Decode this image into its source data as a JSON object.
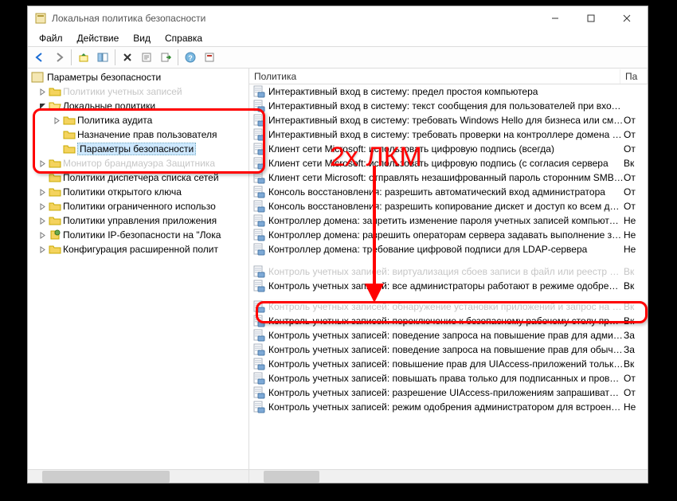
{
  "window": {
    "title": "Локальная политика безопасности"
  },
  "menubar": [
    "Файл",
    "Действие",
    "Вид",
    "Справка"
  ],
  "tree": {
    "root": "Параметры безопасности",
    "items": [
      {
        "label": "Политики учетных записей",
        "expandable": true,
        "depth": 0,
        "open": false,
        "dim": true
      },
      {
        "label": "Локальные политики",
        "expandable": true,
        "depth": 0,
        "open": true
      },
      {
        "label": "Политика аудита",
        "expandable": true,
        "depth": 1,
        "open": false
      },
      {
        "label": "Назначение прав пользователя",
        "expandable": false,
        "depth": 1,
        "open": false
      },
      {
        "label": "Параметры безопасности",
        "expandable": false,
        "depth": 1,
        "open": false,
        "selected": true
      },
      {
        "label": "Монитор брандмауэра Защитника",
        "expandable": true,
        "depth": 0,
        "open": false,
        "dim": true
      },
      {
        "label": "Политики диспетчера списка сетей",
        "expandable": false,
        "depth": 0,
        "open": false
      },
      {
        "label": "Политики открытого ключа",
        "expandable": true,
        "depth": 0,
        "open": false
      },
      {
        "label": "Политики ограниченного использо",
        "expandable": true,
        "depth": 0,
        "open": false
      },
      {
        "label": "Политики управления приложения",
        "expandable": true,
        "depth": 0,
        "open": false
      },
      {
        "label": "Политики IP-безопасности на \"Лока",
        "expandable": true,
        "depth": 0,
        "open": false,
        "ipsec": true
      },
      {
        "label": "Конфигурация расширенной полит",
        "expandable": true,
        "depth": 0,
        "open": false
      }
    ]
  },
  "list": {
    "columns": [
      "Политика",
      "Па"
    ],
    "rows": [
      {
        "name": "Интерактивный вход в систему: предел простоя компьютера",
        "val": ""
      },
      {
        "name": "Интерактивный вход в систему: текст сообщения для пользователей при входе в си...",
        "val": ""
      },
      {
        "name": "Интерактивный вход в систему: требовать Windows Hello для бизнеса или смарт-ка...",
        "val": "От"
      },
      {
        "name": "Интерактивный вход в систему: требовать проверки на контроллере домена для от...",
        "val": "От"
      },
      {
        "name": "Клиент сети Microsoft: использовать цифровую подпись (всегда)",
        "val": "От"
      },
      {
        "name": "Клиент сети Microsoft: использовать цифровую подпись (с согласия сервера",
        "val": "Вк"
      },
      {
        "name": "Клиент сети Microsoft: отправлять незашифрованный пароль сторонним SMB-серв...",
        "val": "От"
      },
      {
        "name": "Консоль восстановления: разрешить автоматический вход администратора",
        "val": "От"
      },
      {
        "name": "Консоль восстановления: разрешить копирование дискет и доступ ко всем дискам ...",
        "val": "От"
      },
      {
        "name": "Контроллер домена: запретить изменение пароля учетных записей компьютера",
        "val": "Не"
      },
      {
        "name": "Контроллер домена: разрешить операторам сервера задавать выполнение заданий",
        "val": "Не"
      },
      {
        "name": "Контроллер домена: требование цифровой подписи для LDAP-сервера",
        "val": "Не"
      },
      {
        "name": "Контроль учетных записей: виртуализация сбоев записи в файл или реестр на осно...",
        "val": "Вк",
        "dim": true
      },
      {
        "name": "Контроль учетных записей: все администраторы работают в режиме одобрения ад...",
        "val": "Вк",
        "highlight": true
      },
      {
        "name": "Контроль учетных записей: обнаружение установки приложений и запрос на пов...",
        "val": "Вк",
        "dim": true
      },
      {
        "name": "Контроль учетных записей: переключение к безопасному рабочему столу при вып...",
        "val": "Вк"
      },
      {
        "name": "Контроль учетных записей: поведение запроса на повышение прав для администра...",
        "val": "За"
      },
      {
        "name": "Контроль учетных записей: поведение запроса на повышение прав для обычных по...",
        "val": "За"
      },
      {
        "name": "Контроль учетных записей: повышение прав для UIAccess-приложений только при...",
        "val": "Вк"
      },
      {
        "name": "Контроль учетных записей: повышать права только для подписанных и проверенн...",
        "val": "От"
      },
      {
        "name": "Контроль учетных записей: разрешение UIAccess-приложениям запрашивать пов...",
        "val": "От"
      },
      {
        "name": "Контроль учетных записей: режим одобрения администратором для встроенной у...",
        "val": "Не"
      }
    ]
  },
  "annotation": {
    "text": "2х ЛКМ"
  }
}
